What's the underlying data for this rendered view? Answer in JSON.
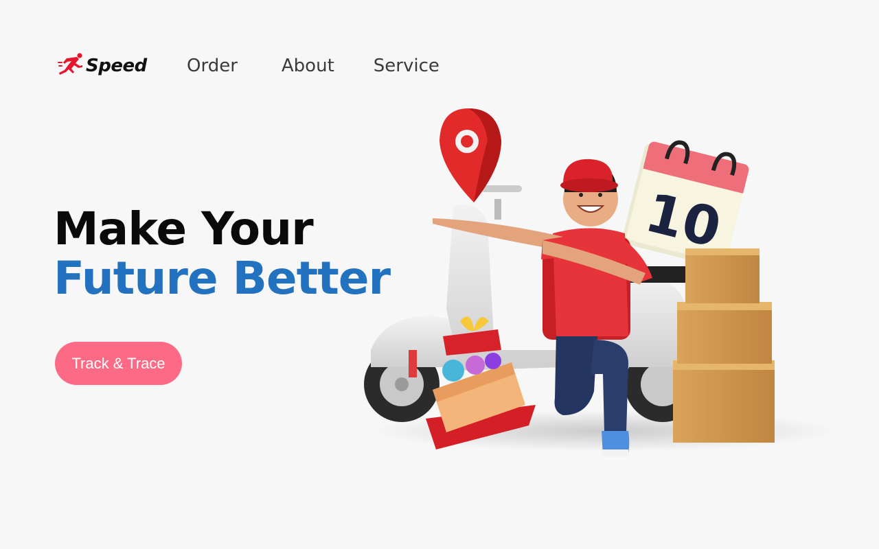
{
  "brand": {
    "name": "Speed",
    "icon": "running-man-icon",
    "accent_color": "#e8152f"
  },
  "nav": {
    "items": [
      {
        "label": "Order"
      },
      {
        "label": "About"
      },
      {
        "label": "Service"
      }
    ]
  },
  "hero": {
    "title_line1": "Make Your",
    "title_line2": "Future Better",
    "title_line2_color": "#2272c0",
    "cta_label": "Track & Trace",
    "cta_color": "#fd6a85"
  },
  "illustration": {
    "calendar_day": "10"
  }
}
